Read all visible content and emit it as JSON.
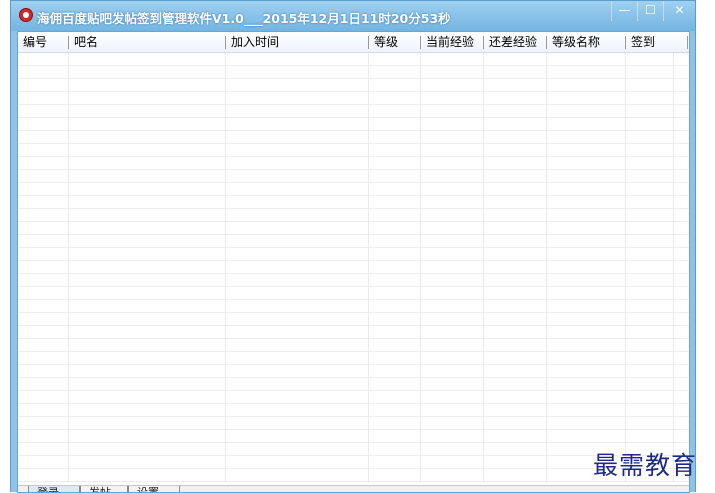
{
  "window": {
    "title": "海佣百度贴吧发帖签到管理软件V1.0___2015年12月1日11时20分53秒",
    "icon": "app-logo-icon",
    "buttons": {
      "minimize": "—",
      "maximize": "☐",
      "close": "✕"
    }
  },
  "table": {
    "columns": [
      "编号",
      "吧名",
      "加入时间",
      "等级",
      "当前经验",
      "还差经验",
      "等级名称",
      "签到"
    ],
    "rows": []
  },
  "tabs": {
    "items": [
      "登录",
      "发帖",
      "设置"
    ],
    "active_index": 0
  },
  "watermark": "最需教育"
}
